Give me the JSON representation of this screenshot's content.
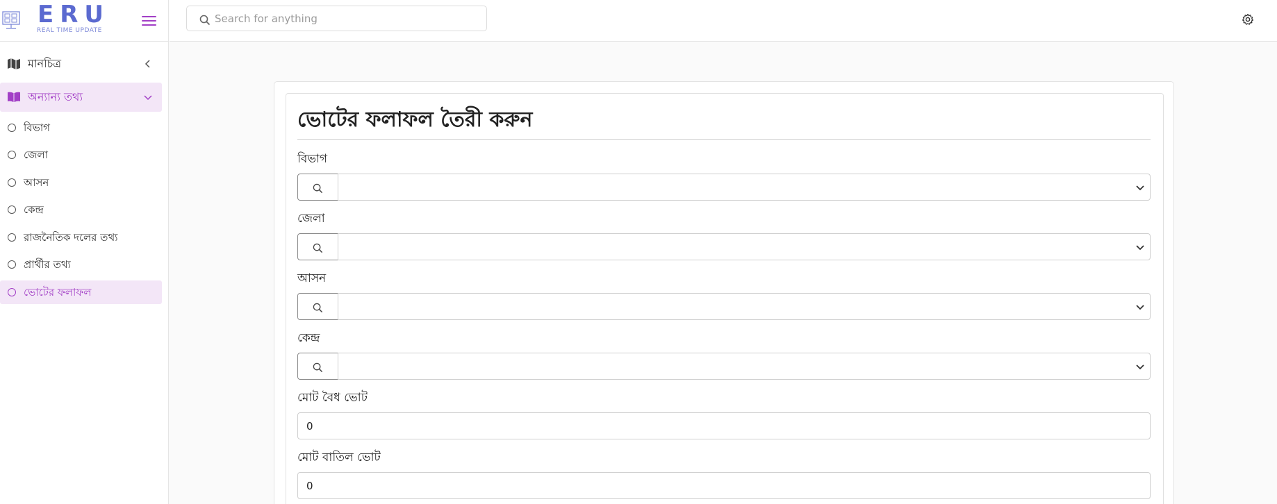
{
  "brand": {
    "title": "ERU",
    "subtitle": "REAL TIME UPDATE",
    "accent_color": "#a23fc6",
    "logo_color": "#5b6ad0"
  },
  "header": {
    "search_placeholder": "Search for anything",
    "search_value": ""
  },
  "sidebar": {
    "items": [
      {
        "label": "মানচিত্র",
        "icon": "map-icon",
        "chevron": "chevron-left-icon"
      },
      {
        "label": "অন্যান্য তথ্য",
        "icon": "book-open-icon",
        "chevron": "chevron-down-icon",
        "expanded": true
      }
    ],
    "subitems": [
      {
        "label": "বিভাগ"
      },
      {
        "label": "জেলা"
      },
      {
        "label": "আসন"
      },
      {
        "label": "কেন্দ্র"
      },
      {
        "label": "রাজনৈতিক দলের তথ্য"
      },
      {
        "label": "প্রার্থীর তথ্য"
      },
      {
        "label": "ভোটের ফলাফল",
        "active": true
      }
    ]
  },
  "form": {
    "title": "ভোটের ফলাফল তৈরী করুন",
    "fields": {
      "division": {
        "label": "বিভাগ",
        "value": ""
      },
      "district": {
        "label": "জেলা",
        "value": ""
      },
      "seat": {
        "label": "আসন",
        "value": ""
      },
      "center": {
        "label": "কেন্দ্র",
        "value": ""
      },
      "valid_votes": {
        "label": "মোট বৈধ ভোট",
        "value": "0"
      },
      "invalid_votes": {
        "label": "মোট বাতিল ভোট",
        "value": "0"
      }
    }
  }
}
